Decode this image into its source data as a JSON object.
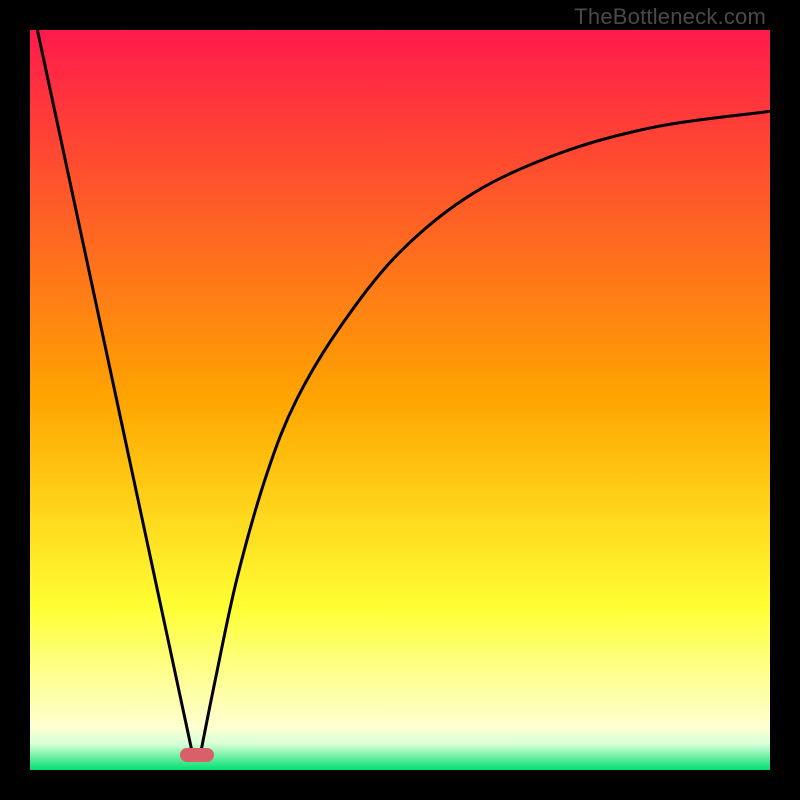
{
  "watermark": "TheBottleneck.com",
  "marker": {
    "color": "#d9606a"
  },
  "chart_data": {
    "type": "line",
    "title": "",
    "xlabel": "",
    "ylabel": "",
    "xlim": [
      0,
      100
    ],
    "ylim": [
      0,
      100
    ],
    "background_gradient": [
      {
        "stop": 0.0,
        "color": "#ff1a4b"
      },
      {
        "stop": 0.5,
        "color": "#ffa500"
      },
      {
        "stop": 0.78,
        "color": "#ffff33"
      },
      {
        "stop": 0.88,
        "color": "#ffff99"
      },
      {
        "stop": 0.94,
        "color": "#ffffd0"
      },
      {
        "stop": 0.965,
        "color": "#d8ffd8"
      },
      {
        "stop": 1.0,
        "color": "#00e070"
      }
    ],
    "series": [
      {
        "name": "left-line",
        "type": "segment",
        "points": [
          {
            "x": 1.0,
            "y": 100
          },
          {
            "x": 22.0,
            "y": 2
          }
        ]
      },
      {
        "name": "right-curve",
        "type": "curve",
        "points": [
          {
            "x": 23.0,
            "y": 2
          },
          {
            "x": 25.0,
            "y": 12
          },
          {
            "x": 28.0,
            "y": 26
          },
          {
            "x": 32.0,
            "y": 40
          },
          {
            "x": 36.0,
            "y": 50
          },
          {
            "x": 42.0,
            "y": 60
          },
          {
            "x": 50.0,
            "y": 70
          },
          {
            "x": 60.0,
            "y": 78
          },
          {
            "x": 72.0,
            "y": 83.5
          },
          {
            "x": 85.0,
            "y": 87
          },
          {
            "x": 100.0,
            "y": 89
          }
        ]
      }
    ],
    "marker_point": {
      "x": 22.5,
      "y": 2
    }
  }
}
